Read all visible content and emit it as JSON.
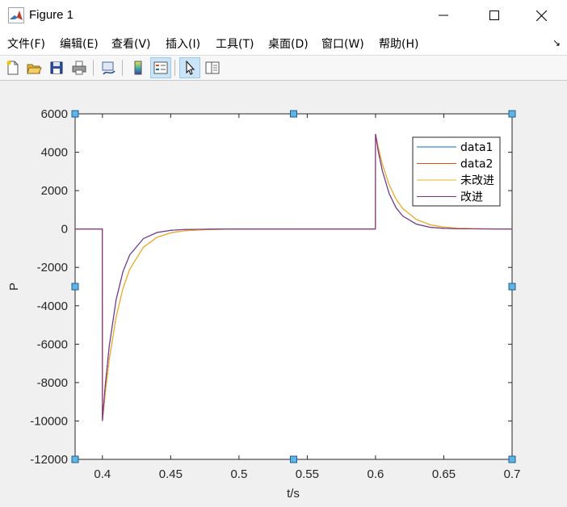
{
  "window": {
    "title": "Figure 1",
    "controls": [
      "minimize",
      "maximize",
      "close"
    ]
  },
  "menu": {
    "items": [
      "文件(F)",
      "编辑(E)",
      "查看(V)",
      "插入(I)",
      "工具(T)",
      "桌面(D)",
      "窗口(W)",
      "帮助(H)"
    ]
  },
  "toolbar": {
    "icons": [
      "new-figure-icon",
      "open-file-icon",
      "save-icon",
      "print-icon",
      "link-plot-icon",
      "insert-colorbar-icon",
      "insert-legend-icon",
      "edit-plot-arrow-icon",
      "property-inspector-icon"
    ]
  },
  "colors": {
    "data1": "#0072bd",
    "data2": "#d95319",
    "unimproved": "#edb120",
    "improved": "#7e2f8e",
    "selection_handle": "#5fb4e6"
  },
  "chart_data": {
    "type": "line",
    "title": "",
    "xlabel": "t/s",
    "ylabel": "P",
    "xlim": [
      0.38,
      0.7
    ],
    "ylim": [
      -12000,
      6000
    ],
    "xticks": [
      0.4,
      0.45,
      0.5,
      0.55,
      0.6,
      0.65,
      0.7
    ],
    "yticks": [
      -12000,
      -10000,
      -8000,
      -6000,
      -4000,
      -2000,
      0,
      2000,
      4000,
      6000
    ],
    "grid": false,
    "legend_position": "top-right",
    "series": [
      {
        "name": "data1",
        "color": "#0072bd",
        "x": [
          0.38,
          0.3999,
          0.4,
          0.402,
          0.405,
          0.41,
          0.415,
          0.42,
          0.43,
          0.44,
          0.45,
          0.46,
          0.48,
          0.5,
          0.55,
          0.5999,
          0.6,
          0.602,
          0.605,
          0.61,
          0.615,
          0.62,
          0.63,
          0.64,
          0.65,
          0.66,
          0.68,
          0.7
        ],
        "y": [
          0,
          0,
          -10000,
          -8200,
          -6100,
          -3700,
          -2230,
          -1350,
          -500,
          -180,
          -70,
          -25,
          -5,
          0,
          0,
          0,
          4950,
          4050,
          3030,
          1840,
          1110,
          670,
          250,
          90,
          35,
          12,
          2,
          0
        ]
      },
      {
        "name": "data2",
        "color": "#d95319",
        "x": [
          0.38,
          0.3999,
          0.4,
          0.402,
          0.405,
          0.41,
          0.415,
          0.42,
          0.43,
          0.44,
          0.45,
          0.46,
          0.48,
          0.5,
          0.55,
          0.5999,
          0.6,
          0.602,
          0.605,
          0.61,
          0.615,
          0.62,
          0.63,
          0.64,
          0.65,
          0.66,
          0.68,
          0.7
        ],
        "y": [
          0,
          0,
          -10000,
          -8600,
          -6800,
          -4600,
          -3100,
          -2100,
          -950,
          -430,
          -200,
          -90,
          -20,
          -4,
          0,
          0,
          4950,
          4260,
          3380,
          2300,
          1560,
          1060,
          490,
          220,
          100,
          45,
          10,
          0
        ]
      },
      {
        "name": "未改进",
        "color": "#edb120",
        "x": [
          0.38,
          0.3999,
          0.4,
          0.402,
          0.405,
          0.41,
          0.415,
          0.42,
          0.43,
          0.44,
          0.45,
          0.46,
          0.48,
          0.5,
          0.55,
          0.5999,
          0.6,
          0.602,
          0.605,
          0.61,
          0.615,
          0.62,
          0.63,
          0.64,
          0.65,
          0.66,
          0.68,
          0.7
        ],
        "y": [
          0,
          0,
          -10000,
          -8600,
          -6800,
          -4600,
          -3100,
          -2100,
          -950,
          -430,
          -200,
          -90,
          -20,
          -4,
          0,
          0,
          4950,
          4260,
          3380,
          2300,
          1560,
          1060,
          490,
          220,
          100,
          45,
          10,
          0
        ]
      },
      {
        "name": "改进",
        "color": "#7e2f8e",
        "x": [
          0.38,
          0.3999,
          0.4,
          0.402,
          0.405,
          0.41,
          0.415,
          0.42,
          0.43,
          0.44,
          0.45,
          0.46,
          0.48,
          0.5,
          0.55,
          0.5999,
          0.6,
          0.602,
          0.605,
          0.61,
          0.615,
          0.62,
          0.63,
          0.64,
          0.65,
          0.66,
          0.68,
          0.7
        ],
        "y": [
          0,
          0,
          -10000,
          -8200,
          -6100,
          -3700,
          -2230,
          -1350,
          -500,
          -180,
          -70,
          -25,
          -5,
          0,
          0,
          0,
          4950,
          4050,
          3030,
          1840,
          1110,
          670,
          250,
          90,
          35,
          12,
          2,
          0
        ]
      }
    ]
  }
}
